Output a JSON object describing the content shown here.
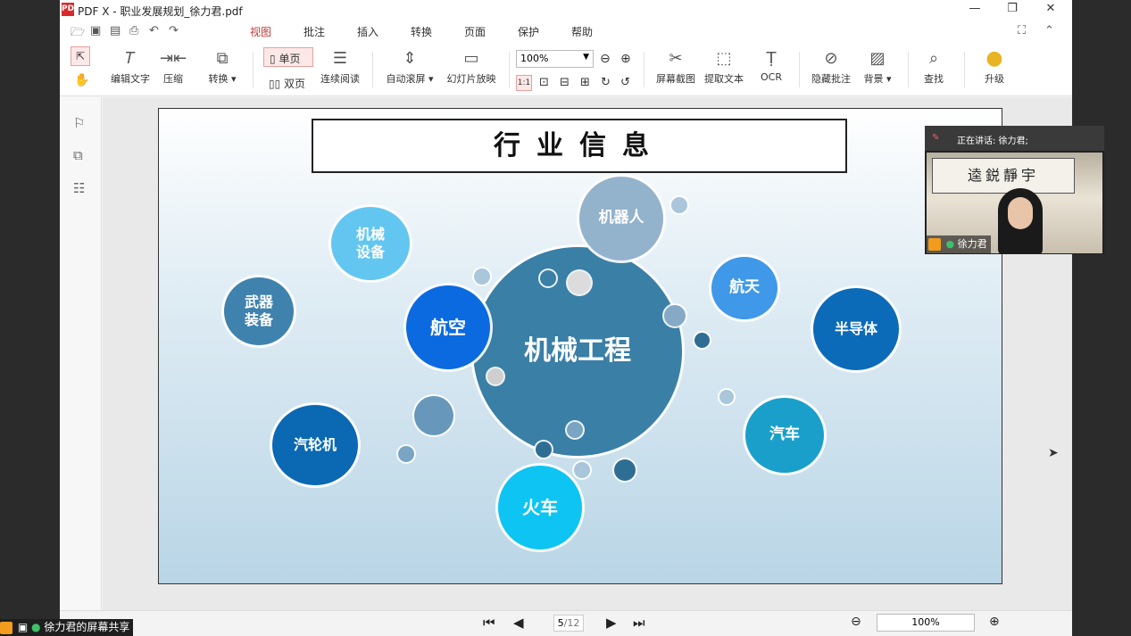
{
  "window": {
    "title": "PDF X - 职业发展规划_徐力君.pdf",
    "logo": "PDF"
  },
  "menu": {
    "tabs": [
      "视图",
      "批注",
      "插入",
      "转换",
      "页面",
      "保护",
      "帮助"
    ],
    "active": "视图"
  },
  "toolbar": {
    "edit_text": "编辑文字",
    "compress": "压缩",
    "convert": "转换 ▾",
    "single_page": "单页",
    "double_page": "双页",
    "continuous": "连续阅读",
    "auto_scroll": "自动滚屏 ▾",
    "slideshow": "幻灯片放映",
    "zoom": "100%",
    "screenshot": "屏幕截图",
    "extract_text": "提取文本",
    "ocr": "OCR",
    "hide_annot": "隐藏批注",
    "background": "背景 ▾",
    "find": "查找",
    "upgrade": "升级"
  },
  "slide": {
    "title": "行业信息",
    "center": "机械工程",
    "bubbles": [
      "机器人",
      "机械设备",
      "航天",
      "武器装备",
      "航空",
      "半导体",
      "汽轮机",
      "汽车",
      "火车"
    ]
  },
  "navigation": {
    "page": "5",
    "total": "/12",
    "zoom": "100%"
  },
  "video": {
    "speaking": "正在讲话: 徐力君;",
    "name": "徐力君",
    "callig": "逵鋭靜宇"
  },
  "share": {
    "label": "徐力君的屏幕共享"
  },
  "colors": {
    "accent": "#c43a3a",
    "center": "#3a7fa6"
  }
}
